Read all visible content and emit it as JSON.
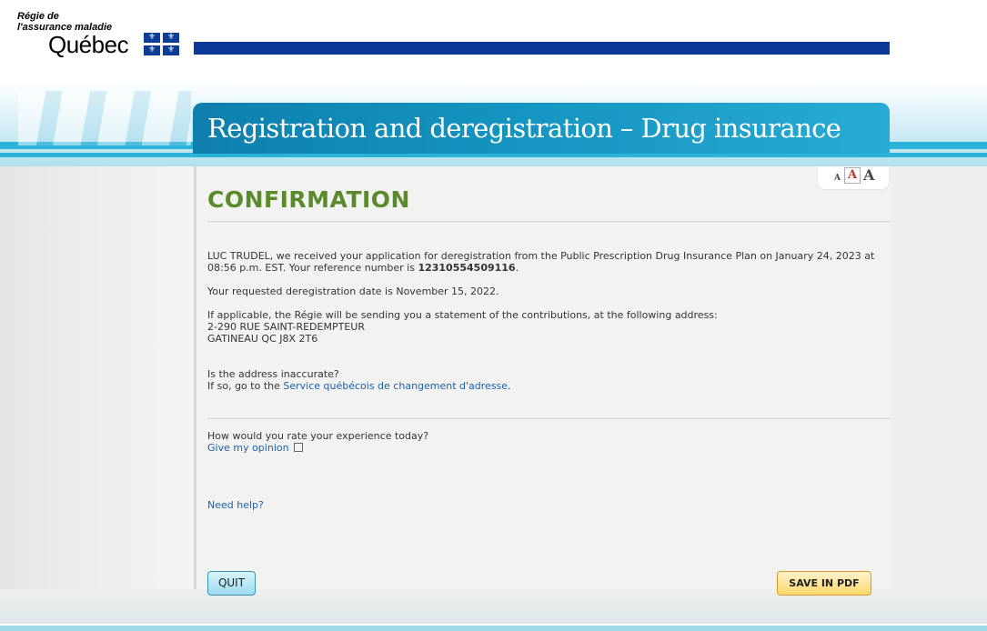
{
  "header": {
    "org_line1": "Régie de",
    "org_line2": "l'assurance maladie",
    "gov_name": "Québec"
  },
  "banner": {
    "title": "Registration and deregistration – Drug insurance"
  },
  "font_sizer": {
    "small": "A",
    "medium": "A",
    "large": "A"
  },
  "content": {
    "heading": "CONFIRMATION",
    "para1_pre": "LUC TRUDEL, we received your application for deregistration from the Public Prescription Drug Insurance Plan on January 24, 2023 at",
    "para1_line2_pre": "08:56 p.m. EST. Your reference number is ",
    "reference_number": "12310554509116",
    "para1_post": ".",
    "para2": "Your requested deregistration date is November 15, 2022.",
    "para3": "If applicable, the Régie will be sending you a statement of the contributions, at the following address:",
    "address_line1": "2-290 RUE SAINT-REDEMPTEUR",
    "address_line2": "GATINEAU QC J8X 2T6",
    "addr_question": "Is the address inaccurate?",
    "addr_instruction_pre": "If so, go to the ",
    "addr_link": "Service québécois de changement d'adresse",
    "addr_instruction_post": ".",
    "rating_question": "How would you rate your experience today?",
    "rating_link": "Give my opinion",
    "help_link": "Need help?"
  },
  "buttons": {
    "quit": "QUIT",
    "save_pdf": "SAVE IN PDF"
  },
  "colors": {
    "brand_blue": "#0b3a99",
    "heading_green": "#5a8a2c",
    "link_blue": "#1c5fa8"
  }
}
